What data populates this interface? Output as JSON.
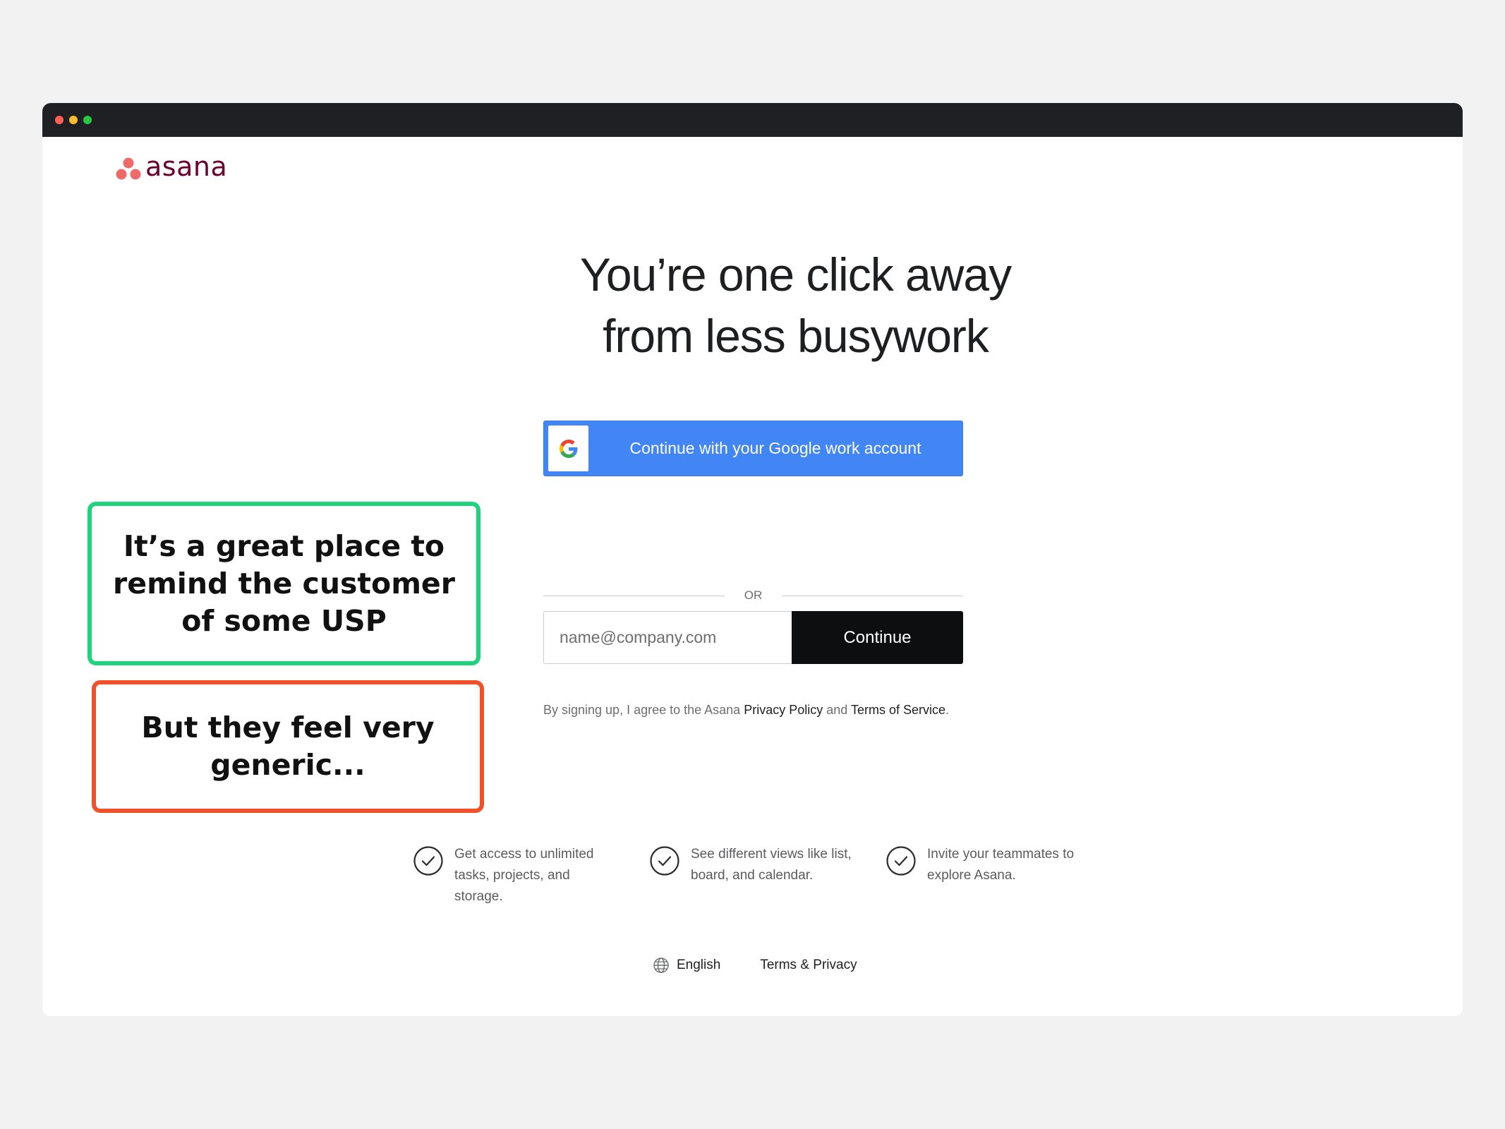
{
  "window": {
    "traffic_lights": [
      "close",
      "minimize",
      "maximize"
    ]
  },
  "brand": {
    "logo_text": "asana",
    "logo_color": "#690031",
    "logo_dot_color": "#f06a6a"
  },
  "signup": {
    "headline_line1": "You’re one click away",
    "headline_line2": "from less busywork",
    "google_button_label": "Continue with your Google work account",
    "or_label": "OR",
    "email_placeholder": "name@company.com",
    "email_value": "",
    "continue_label": "Continue",
    "legal_prefix": "By signing up, I agree to the Asana",
    "privacy_link": "Privacy Policy",
    "legal_and": "and",
    "terms_link": "Terms of Service",
    "legal_suffix": "."
  },
  "features": [
    {
      "icon": "check-circle-icon",
      "text": "Get access to unlimited tasks, projects, and storage."
    },
    {
      "icon": "check-circle-icon",
      "text": "See different views like list, board, and calendar."
    },
    {
      "icon": "check-circle-icon",
      "text": "Invite your teammates to explore Asana."
    }
  ],
  "footer": {
    "language_icon": "globe-icon",
    "language_label": "English",
    "terms_label": "Terms & Privacy"
  },
  "annotations": {
    "green_note": "It’s a great place to remind the customer of some USP",
    "red_note": "But they feel very generic...",
    "green_color": "#1ed37c",
    "red_color": "#f2502b"
  },
  "colors": {
    "google_blue": "#4285f4",
    "continue_black": "#0d0e10",
    "titlebar": "#1f2024",
    "page_background": "#f2f2f2"
  }
}
